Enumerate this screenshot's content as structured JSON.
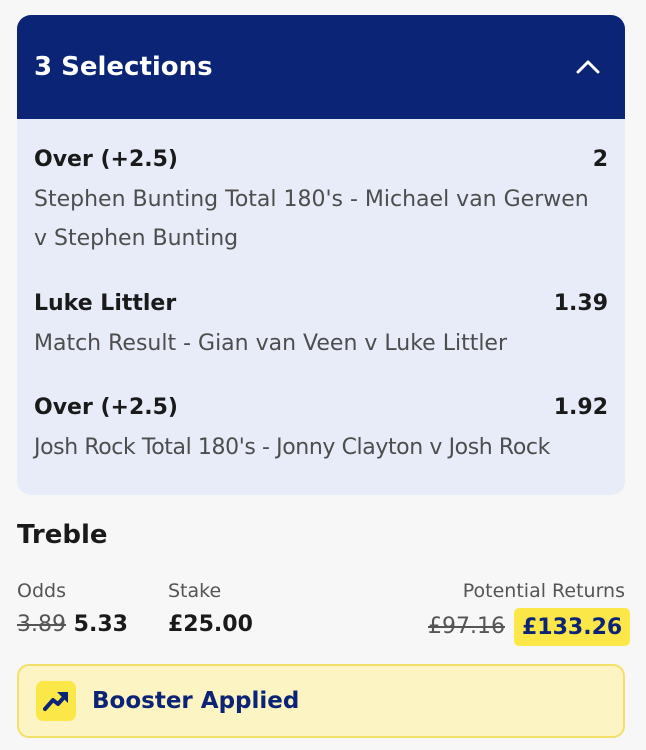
{
  "selections_card": {
    "title": "3 Selections",
    "toggle_icon": "chevron-up-icon",
    "items": [
      {
        "name": "Over (+2.5)",
        "odds": "2",
        "description": "Stephen Bunting Total 180's - Michael van Gerwen v Stephen Bunting"
      },
      {
        "name": "Luke Littler",
        "odds": "1.39",
        "description": "Match Result - Gian van Veen v Luke Littler"
      },
      {
        "name": "Over (+2.5)",
        "odds": "1.92",
        "description": "Josh Rock Total 180's - Jonny Clayton v Josh Rock"
      }
    ]
  },
  "treble": {
    "title": "Treble",
    "odds_label": "Odds",
    "odds_old": "3.89",
    "odds_new": "5.33",
    "stake_label": "Stake",
    "stake_value": "£25.00",
    "returns_label": "Potential Returns",
    "returns_old": "£97.16",
    "returns_new": "£133.26"
  },
  "booster": {
    "icon": "trending-up-icon",
    "label": "Booster Applied"
  },
  "colors": {
    "header_bg": "#0b2475",
    "card_bg": "#e7ecf8",
    "highlight_yellow": "#fce748",
    "booster_bg": "#fdf4c3"
  }
}
